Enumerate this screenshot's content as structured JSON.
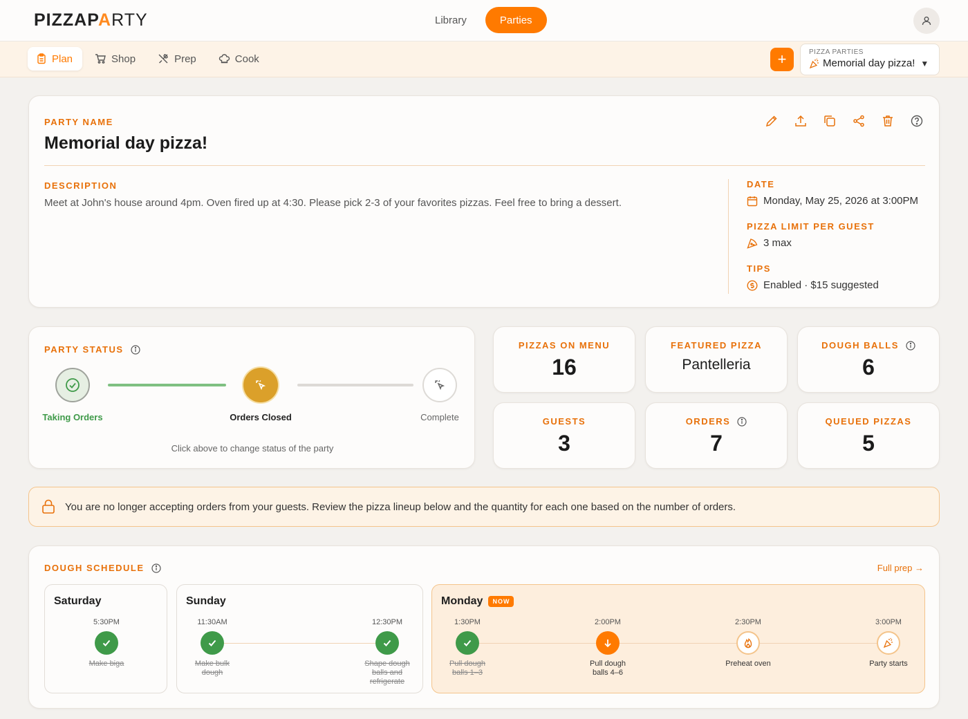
{
  "app": {
    "logo_left": "PIZZAP",
    "logo_a": "A",
    "logo_right": "RTY"
  },
  "topnav": {
    "items": [
      {
        "label": "Library",
        "active": false
      },
      {
        "label": "Parties",
        "active": true
      }
    ]
  },
  "subnav": {
    "tabs": [
      {
        "label": "Plan",
        "icon": "clipboard-icon",
        "active": true
      },
      {
        "label": "Shop",
        "icon": "cart-icon",
        "active": false
      },
      {
        "label": "Prep",
        "icon": "utensils-icon",
        "active": false
      },
      {
        "label": "Cook",
        "icon": "chef-hat-icon",
        "active": false
      }
    ],
    "add_label": "+",
    "party_select": {
      "label": "PIZZA PARTIES",
      "value": "Memorial day pizza!",
      "caret": "▼"
    }
  },
  "party": {
    "name_label": "PARTY NAME",
    "name": "Memorial day pizza!",
    "description_label": "DESCRIPTION",
    "description": "Meet at John's house around 4pm. Oven fired up at 4:30. Please pick 2-3 of your favorites pizzas. Feel free to bring a dessert.",
    "date_label": "DATE",
    "date": "Monday, May 25, 2026 at 3:00PM",
    "limit_label": "PIZZA LIMIT PER GUEST",
    "limit": "3 max",
    "tips_label": "TIPS",
    "tips": "Enabled · $15 suggested"
  },
  "status": {
    "label": "PARTY STATUS",
    "steps": [
      {
        "label": "Taking Orders",
        "state": "done"
      },
      {
        "label": "Orders Closed",
        "state": "current"
      },
      {
        "label": "Complete",
        "state": "upcoming"
      }
    ],
    "hint": "Click above to change status of the party"
  },
  "stats": {
    "pizzas_on_menu": {
      "label": "PIZZAS ON MENU",
      "value": "16"
    },
    "featured_pizza": {
      "label": "FEATURED PIZZA",
      "value": "Pantelleria"
    },
    "dough_balls": {
      "label": "DOUGH BALLS",
      "value": "6"
    },
    "guests": {
      "label": "GUESTS",
      "value": "3"
    },
    "orders": {
      "label": "ORDERS",
      "value": "7"
    },
    "queued_pizzas": {
      "label": "QUEUED PIZZAS",
      "value": "5"
    }
  },
  "notice": "You are no longer accepting orders from your guests. Review the pizza lineup below and the quantity for each one based on the number of orders.",
  "dough": {
    "label": "DOUGH SCHEDULE",
    "full_prep": "Full prep →",
    "now_badge": "NOW",
    "saturday": {
      "name": "Saturday",
      "events": [
        {
          "time": "5:30PM",
          "text": "Make biga",
          "state": "done"
        }
      ]
    },
    "sunday": {
      "name": "Sunday",
      "events": [
        {
          "time": "11:30AM",
          "text": "Make bulk dough",
          "state": "done"
        },
        {
          "time": "12:30PM",
          "text": "Shape dough balls and refrigerate",
          "state": "done"
        }
      ]
    },
    "monday": {
      "name": "Monday",
      "events": [
        {
          "time": "1:30PM",
          "text": "Pull dough balls 1–3",
          "state": "done"
        },
        {
          "time": "2:00PM",
          "text": "Pull dough balls 4–6",
          "state": "current"
        },
        {
          "time": "2:30PM",
          "text": "Preheat oven",
          "state": "upcoming"
        },
        {
          "time": "3:00PM",
          "text": "Party starts",
          "state": "upcoming"
        }
      ]
    }
  },
  "colors": {
    "accent": "#ff7a00",
    "success": "#3f9a49",
    "label": "#e8710a"
  }
}
